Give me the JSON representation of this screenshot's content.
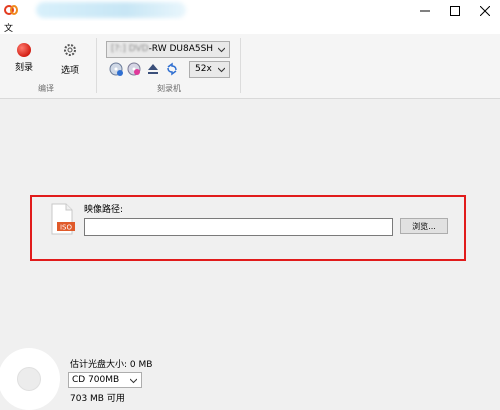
{
  "window": {
    "minimize_label": "—",
    "maximize_label": "☐",
    "close_label": "✕"
  },
  "menu": {
    "file_label": "文"
  },
  "ribbon": {
    "burn_label": "刻录",
    "options_label": "选项",
    "group_edit": "编译",
    "group_burner": "刻录机",
    "drive": "-RW DU8A5SH",
    "drive_blurred_prefix": "[?:] DVD",
    "speed": "52x"
  },
  "main": {
    "image_path_label": "映像路径:",
    "image_path_value": "",
    "browse_label": "浏览...",
    "iso_badge": "ISO"
  },
  "footer": {
    "estimated_size": "估计光盘大小: 0 MB",
    "disc_type": "CD 700MB",
    "free_space": "703 MB 可用"
  },
  "colors": {
    "highlight": "#e11b1b",
    "record_button": "#d21f14"
  },
  "icons": [
    "app-logo-icon",
    "record-icon",
    "gear-icon",
    "disc-info-icon",
    "erase-icon",
    "eject-icon",
    "refresh-icon",
    "iso-file-icon",
    "chevron-down-icon",
    "disc-icon"
  ]
}
